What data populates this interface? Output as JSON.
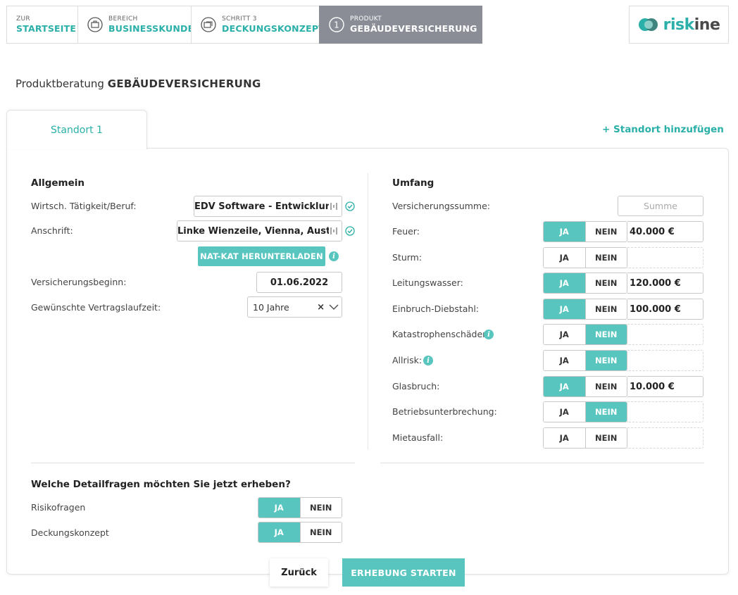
{
  "nav": {
    "items": [
      {
        "small": "ZUR",
        "big": "STARTSEITE"
      },
      {
        "small": "BEREICH",
        "big": "BUSINESSKUNDE"
      },
      {
        "small": "SCHRITT 3",
        "big": "DECKUNGSKONZEPT"
      },
      {
        "small": "PRODUKT",
        "big": "GEBÄUDEVERSICHERUNG",
        "step": "1"
      }
    ],
    "logo": {
      "text_a": "risk",
      "text_b": "ine",
      "icon": "riskine-logo-circles"
    }
  },
  "title": {
    "prefix": "Produktberatung",
    "product": "GEBÄUDEVERSICHERUNG"
  },
  "tabs": {
    "active": "Standort 1",
    "add": "+ Standort hinzufügen"
  },
  "colors": {
    "accent": "#58c6bf",
    "accent_text": "#2ab0a8",
    "active_nav": "#8a8d96"
  },
  "allgemein": {
    "heading": "Allgemein",
    "beruf_label": "Wirtsch. Tätigkeit/Beruf:",
    "beruf_value": "EDV Software - Entwicklung",
    "anschrift_label": "Anschrift:",
    "anschrift_value": "Linke Wienzeile, Vienna, Austria",
    "natkat_button": "NAT-KAT HERUNTERLADEN",
    "beginn_label": "Versicherungsbeginn:",
    "beginn_value": "01.06.2022",
    "laufzeit_label": "Gewünschte Vertragslaufzeit:",
    "laufzeit_value": "10 Jahre",
    "clear_glyph": "×"
  },
  "umfang": {
    "heading": "Umfang",
    "summe_label": "Versicherungssumme:",
    "summe_placeholder": "Summe",
    "ja": "JA",
    "nein": "NEIN",
    "rows": [
      {
        "label": "Feuer:",
        "selected": "ja",
        "amount": "40.000 €"
      },
      {
        "label": "Sturm:",
        "selected": "none",
        "amount": ""
      },
      {
        "label": "Leitungswasser:",
        "selected": "ja",
        "amount": "120.000 €"
      },
      {
        "label": "Einbruch-Diebstahl:",
        "selected": "ja",
        "amount": "100.000 €"
      },
      {
        "label": "Katastrophenschäden:",
        "selected": "nein",
        "amount": "",
        "info": true
      },
      {
        "label": "Allrisk:",
        "selected": "nein",
        "amount": "",
        "info": true
      },
      {
        "label": "Glasbruch:",
        "selected": "ja",
        "amount": "10.000 €"
      },
      {
        "label": "Betriebsunterbrechung:",
        "selected": "nein",
        "amount": ""
      },
      {
        "label": "Mietausfall:",
        "selected": "none",
        "amount": ""
      }
    ]
  },
  "detail": {
    "heading": "Welche Detailfragen möchten Sie jetzt erheben?",
    "risiko_label": "Risikofragen",
    "deckung_label": "Deckungskonzept"
  },
  "footer": {
    "back": "Zurück",
    "start": "ERHEBUNG STARTEN"
  }
}
